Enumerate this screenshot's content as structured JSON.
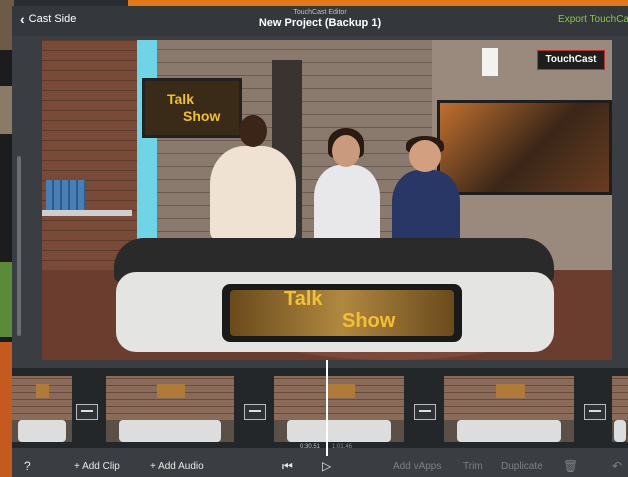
{
  "nav": {
    "back_label": "Cast Side",
    "subtitle": "TouchCast Editor",
    "title": "New Project (Backup 1)",
    "export_label": "Export TouchCas"
  },
  "preview": {
    "logo_text": "TouchCast",
    "monitor_text_line1": "Talk",
    "monitor_text_line2": "Show",
    "desk_text_line1": "Talk",
    "desk_text_line2": "Show"
  },
  "timeline": {
    "timecode_current": "0:30.51",
    "timecode_end": "1:01.46",
    "clips": [
      {
        "name": "clip-1"
      },
      {
        "name": "clip-2"
      },
      {
        "name": "clip-3"
      },
      {
        "name": "clip-4"
      }
    ]
  },
  "toolbar": {
    "help": "?",
    "add_clip": "+ Add Clip",
    "add_audio": "+ Add Audio",
    "skip_start_icon": "skip-to-start-icon",
    "play_icon": "play-icon",
    "add_vapps": "Add vApps",
    "trim": "Trim",
    "duplicate": "Duplicate",
    "trash_icon": "trash-icon",
    "undo_icon": "undo-icon"
  },
  "colors": {
    "accent_export": "#8fc04a",
    "logo_border": "#c0302a"
  }
}
